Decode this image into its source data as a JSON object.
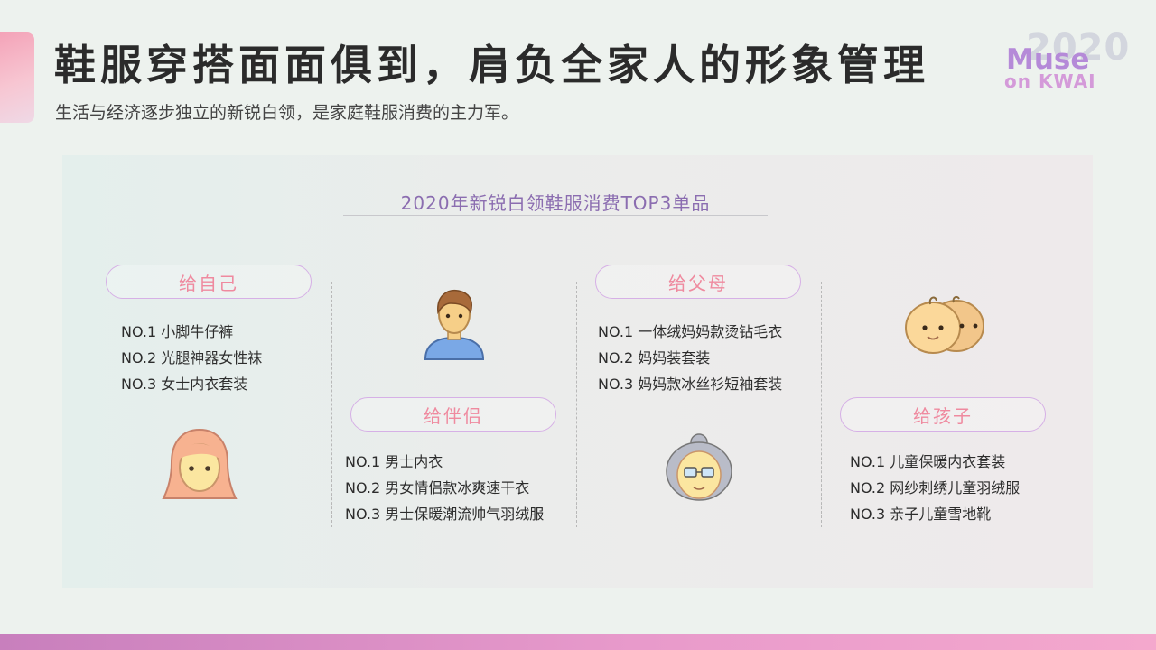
{
  "header": {
    "title": "鞋服穿搭面面俱到，肩负全家人的形象管理",
    "subtitle": "生活与经济逐步独立的新锐白领，是家庭鞋服消费的主力军。"
  },
  "logo": {
    "year": "2020",
    "line1": "Muse",
    "line2": "on KWAI"
  },
  "panel": {
    "title": "2020年新锐白领鞋服消费TOP3单品",
    "groups": [
      {
        "label": "给自己",
        "icon": "woman-avatar-icon",
        "items": [
          "NO.1 小脚牛仔裤",
          "NO.2 光腿神器女性袜",
          "NO.3 女士内衣套装"
        ]
      },
      {
        "label": "给伴侣",
        "icon": "man-avatar-icon",
        "items": [
          "NO.1 男士内衣",
          "NO.2 男女情侣款冰爽速干衣",
          "NO.3 男士保暖潮流帅气羽绒服"
        ]
      },
      {
        "label": "给父母",
        "icon": "grandmother-avatar-icon",
        "items": [
          "NO.1 一体绒妈妈款烫钻毛衣",
          "NO.2 妈妈装套装",
          "NO.3 妈妈款冰丝衫短袖套装"
        ]
      },
      {
        "label": "给孩子",
        "icon": "babies-avatar-icon",
        "items": [
          "NO.1 儿童保暖内衣套装",
          "NO.2 网纱刺绣儿童羽绒服",
          "NO.3 亲子儿童雪地靴"
        ]
      }
    ]
  },
  "colors": {
    "pill_text": "#ef8a9f",
    "pill_border": "#d6b0e6",
    "panel_title": "#8b6db0",
    "bottom_bar": "#e89acb"
  }
}
